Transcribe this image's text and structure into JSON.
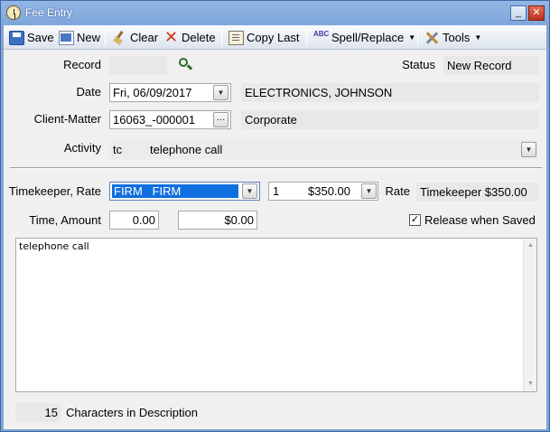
{
  "window": {
    "title": "Fee Entry",
    "minimize_glyph": "_",
    "maximize_glyph": "▢",
    "close_glyph": "✕"
  },
  "toolbar": {
    "save": "Save",
    "new": "New",
    "clear": "Clear",
    "delete": "Delete",
    "copy_last": "Copy Last",
    "spell_replace": "Spell/Replace",
    "tools": "Tools",
    "spell_icon_text": "ABC"
  },
  "record": {
    "label": "Record",
    "value": ""
  },
  "status": {
    "label": "Status",
    "value": "New Record"
  },
  "date": {
    "label": "Date",
    "value": "Fri, 06/09/2017",
    "client_name": "ELECTRONICS, JOHNSON"
  },
  "client_matter": {
    "label": "Client-Matter",
    "value": "16063_-000001",
    "matter_name": "Corporate"
  },
  "activity": {
    "label": "Activity",
    "code": "tc",
    "description": "telephone call"
  },
  "timekeeper": {
    "label": "Timekeeper, Rate",
    "value": "FIRM   FIRM",
    "rate_code": "1",
    "rate_amount": "$350.00",
    "rate_label": "Rate",
    "rate_display": "Timekeeper $350.00"
  },
  "time_amount": {
    "label": "Time, Amount",
    "time": "0.00",
    "amount": "$0.00"
  },
  "release": {
    "label": "Release when Saved",
    "checked": true
  },
  "description": {
    "text": "telephone call"
  },
  "footer": {
    "char_count": "15",
    "char_label": "Characters in Description"
  },
  "colors": {
    "selection": "#0f6fe0",
    "titlebar": "#7fa3d3"
  }
}
